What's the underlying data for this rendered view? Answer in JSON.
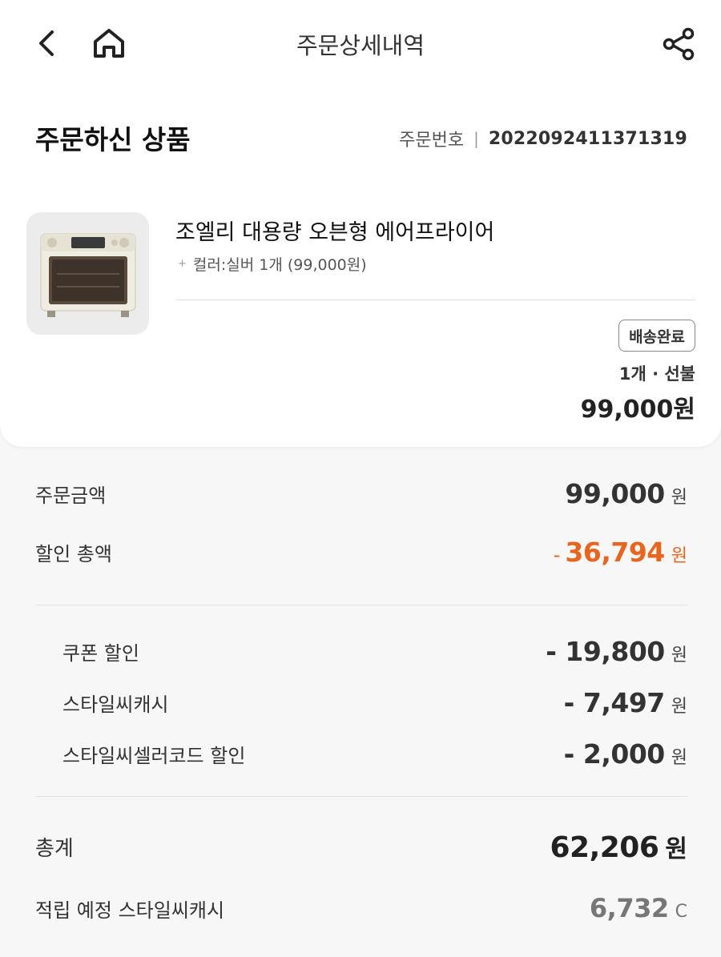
{
  "header": {
    "title": "주문상세내역",
    "back_icon": "chevron-left-icon",
    "home_icon": "home-icon",
    "share_icon": "share-icon"
  },
  "order": {
    "section_title": "주문하신 상품",
    "number_label": "주문번호",
    "number_separator": "|",
    "number": "2022092411371319"
  },
  "product": {
    "name": "조엘리 대용량 오븐형 에어프라이어",
    "option": "컬러:실버 1개 (99,000원)",
    "status": "배송완료",
    "qty_payment": "1개 · 선불",
    "price": "99,000원"
  },
  "summary": {
    "order_amount": {
      "label": "주문금액",
      "amount": "99,000",
      "unit": "원"
    },
    "discount_total": {
      "label": "할인 총액",
      "minus": "-",
      "amount": "36,794",
      "unit": "원"
    },
    "discounts": [
      {
        "label": "쿠폰 할인",
        "amount": "- 19,800",
        "unit": "원"
      },
      {
        "label": "스타일씨캐시",
        "amount": "- 7,497",
        "unit": "원"
      },
      {
        "label": "스타일씨셀러코드 할인",
        "amount": "- 2,000",
        "unit": "원"
      }
    ],
    "total": {
      "label": "총계",
      "amount": "62,206",
      "unit": "원"
    },
    "points": {
      "label": "적립 예정 스타일씨캐시",
      "amount": "6,732",
      "unit": "C"
    }
  },
  "colors": {
    "discount": "#e8651f",
    "background": "#f7f7f7",
    "card": "#ffffff"
  }
}
